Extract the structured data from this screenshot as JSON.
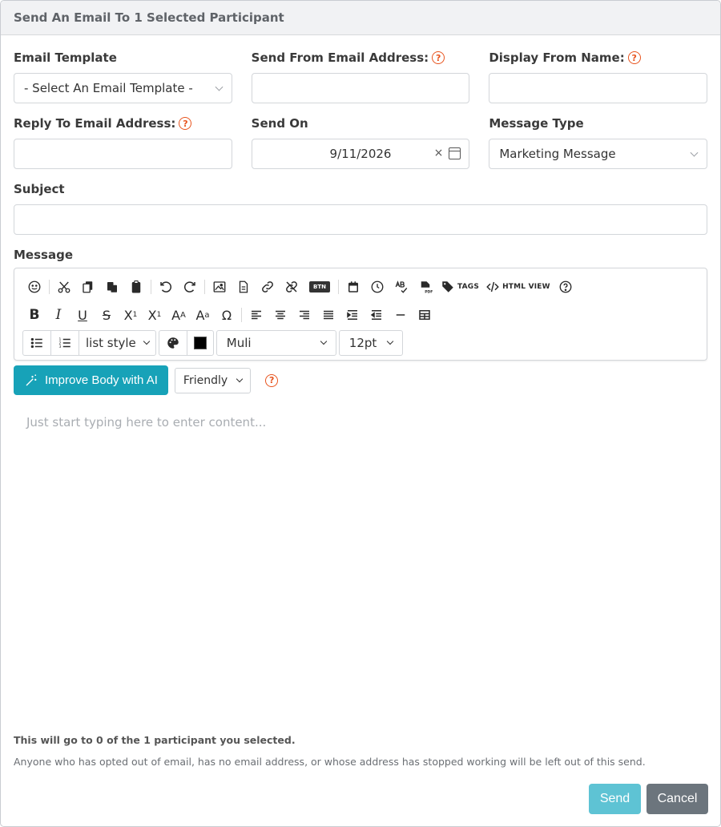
{
  "header": {
    "title": "Send An Email To 1 Selected Participant"
  },
  "fields": {
    "email_template": {
      "label": "Email Template",
      "value": "- Select An Email Template -"
    },
    "send_from": {
      "label": "Send From Email Address:",
      "value": ""
    },
    "display_name": {
      "label": "Display From Name:",
      "value": ""
    },
    "reply_to": {
      "label": "Reply To Email Address:",
      "value": ""
    },
    "send_on": {
      "label": "Send On",
      "value": "9/11/2026",
      "clear": "×"
    },
    "message_type": {
      "label": "Message Type",
      "value": "Marketing Message"
    },
    "subject": {
      "label": "Subject",
      "value": ""
    },
    "message": {
      "label": "Message"
    }
  },
  "help_glyph": "?",
  "toolbar": {
    "tags_label": "TAGS",
    "html_view_label": "HTML VIEW",
    "btn_label": "BTN",
    "list_style_label": "list style",
    "font_value": "Muli",
    "size_value": "12pt",
    "text_color": "#000000"
  },
  "ai": {
    "button_label": "Improve Body with AI",
    "tone_value": "Friendly"
  },
  "editor": {
    "placeholder": "Just start typing here to enter content..."
  },
  "notes": {
    "count_note": "This will go to 0 of the 1 participant you selected.",
    "optout_note": "Anyone who has opted out of email, has no email address, or whose address has stopped working will be left out of this send."
  },
  "actions": {
    "send_label": "Send",
    "cancel_label": "Cancel"
  },
  "colors": {
    "accent": "#17a2b8",
    "help": "#e8541e",
    "send": "#5ec3d4",
    "cancel": "#6c757d"
  }
}
